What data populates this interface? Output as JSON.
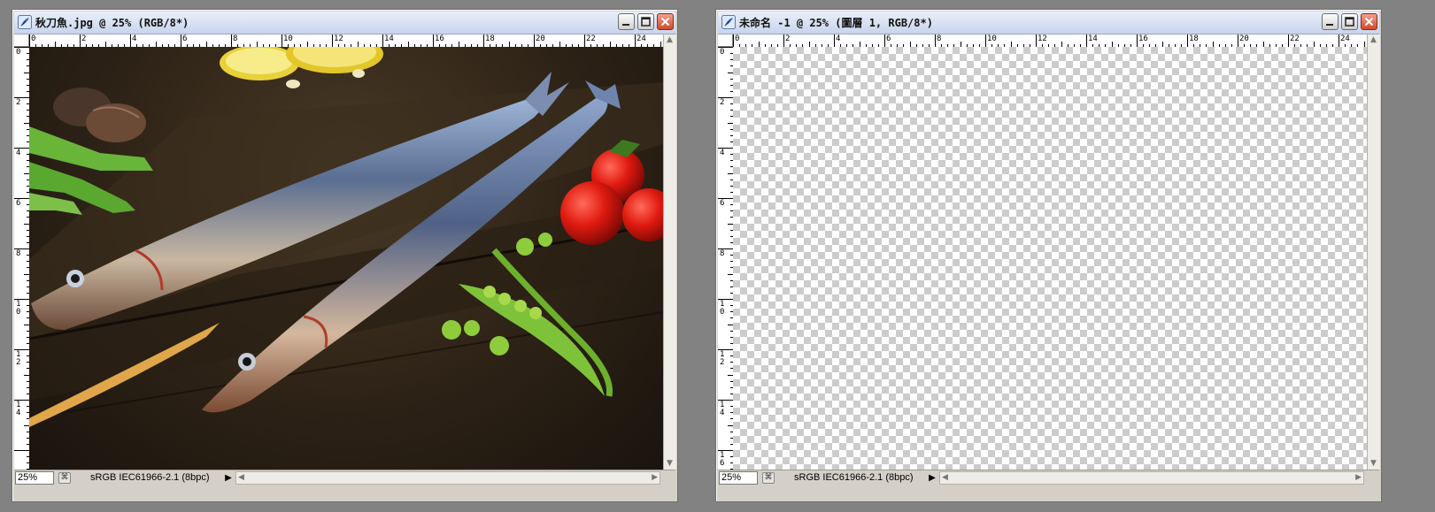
{
  "windows": [
    {
      "title": "秋刀魚.jpg @ 25% (RGB/8*)",
      "zoom": "25%",
      "profile": "sRGB IEC61966-2.1 (8bpc)",
      "ruler_x": [
        "0",
        "2",
        "4",
        "6",
        "8",
        "10",
        "12",
        "14",
        "16",
        "18",
        "20",
        "22",
        "24"
      ],
      "ruler_y": [
        "0",
        "2",
        "4",
        "6",
        "8",
        "10",
        "12",
        "14"
      ],
      "canvas": "photo"
    },
    {
      "title": "未命名 -1 @ 25% (圖層 1, RGB/8*)",
      "zoom": "25%",
      "profile": "sRGB IEC61966-2.1 (8bpc)",
      "ruler_x": [
        "0",
        "2",
        "4",
        "6",
        "8",
        "10",
        "12",
        "14",
        "16",
        "18",
        "20",
        "22",
        "24"
      ],
      "ruler_y": [
        "0",
        "2",
        "4",
        "6",
        "8",
        "10",
        "12",
        "14",
        "16"
      ],
      "canvas": "transparent"
    }
  ],
  "icons": {
    "app": "photoshop-feather-icon",
    "minimize": "minimize-icon",
    "maximize": "maximize-icon",
    "close": "close-icon"
  }
}
